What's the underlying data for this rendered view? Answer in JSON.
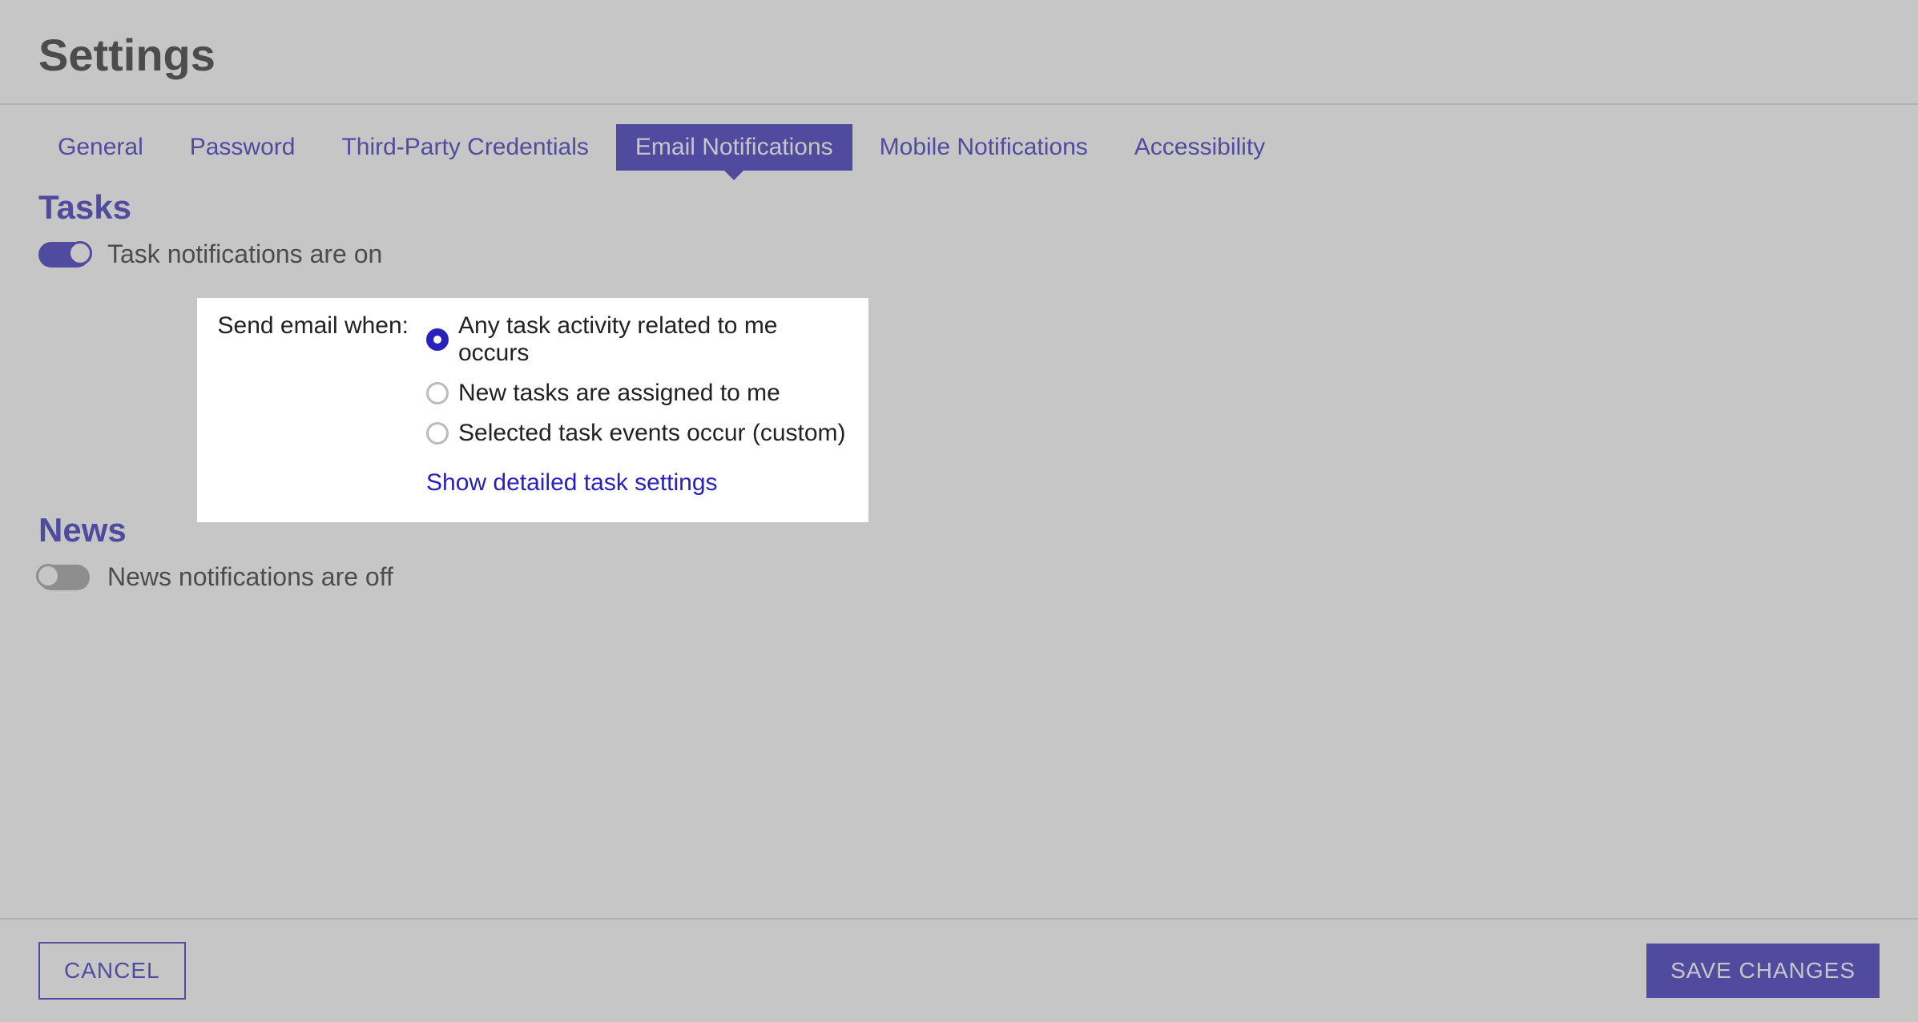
{
  "header": {
    "title": "Settings"
  },
  "tabs": {
    "general": "General",
    "password": "Password",
    "thirdparty": "Third-Party Credentials",
    "email": "Email Notifications",
    "mobile": "Mobile Notifications",
    "accessibility": "Accessibility"
  },
  "tasks": {
    "heading": "Tasks",
    "toggle_label": "Task notifications are on",
    "panel_label": "Send email when:",
    "options": {
      "any": "Any task activity related to me occurs",
      "new": "New tasks are assigned to me",
      "custom": "Selected task events occur (custom)"
    },
    "link": "Show detailed task settings"
  },
  "news": {
    "heading": "News",
    "toggle_label": "News notifications are off"
  },
  "footer": {
    "cancel": "CANCEL",
    "save": "SAVE CHANGES"
  }
}
